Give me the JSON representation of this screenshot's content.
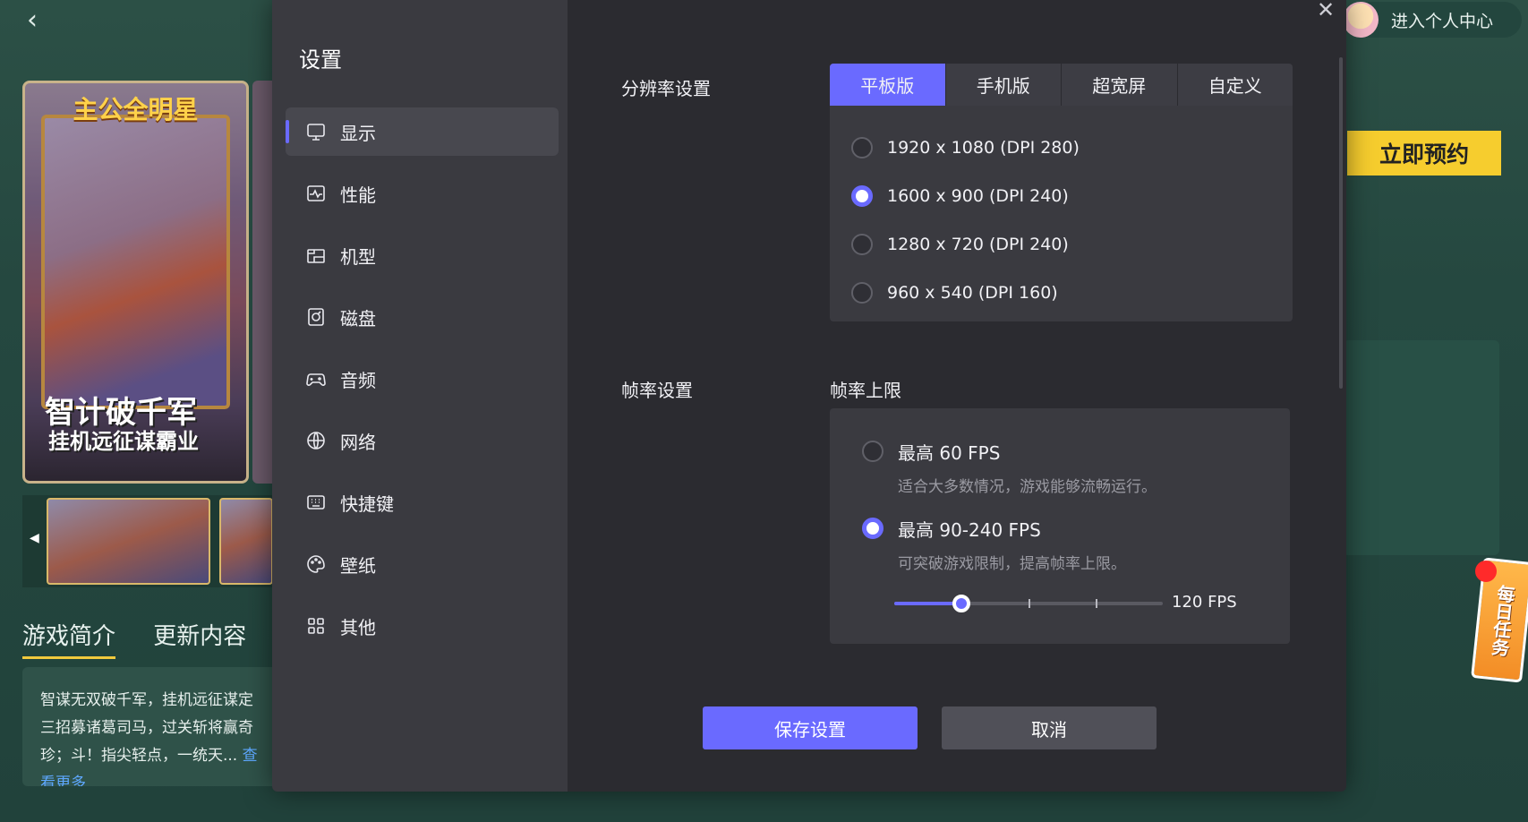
{
  "background": {
    "poster": {
      "title": "主公全明星",
      "slogan_line1": "智计破千军",
      "slogan_line2": "挂机远征谋霸业"
    },
    "tabs": [
      "游戏简介",
      "更新内容"
    ],
    "description": "智谋无双破千军，挂机远征谋定三招募诸葛司马，过关斩将赢奇珍；斗！指尖轻点，一统天...",
    "more_link": "查看更多",
    "user_center": "进入个人中心",
    "reserve_button": "立即预约",
    "daily_task": "每日任务"
  },
  "settings": {
    "title": "设置",
    "nav": [
      {
        "label": "显示",
        "icon": "monitor-icon",
        "active": true
      },
      {
        "label": "性能",
        "icon": "performance-icon",
        "active": false
      },
      {
        "label": "机型",
        "icon": "device-icon",
        "active": false
      },
      {
        "label": "磁盘",
        "icon": "disk-icon",
        "active": false
      },
      {
        "label": "音频",
        "icon": "gamepad-icon",
        "active": false
      },
      {
        "label": "网络",
        "icon": "globe-icon",
        "active": false
      },
      {
        "label": "快捷键",
        "icon": "keyboard-icon",
        "active": false
      },
      {
        "label": "壁纸",
        "icon": "palette-icon",
        "active": false
      },
      {
        "label": "其他",
        "icon": "grid-icon",
        "active": false
      }
    ],
    "resolution": {
      "label": "分辨率设置",
      "tabs": [
        "平板版",
        "手机版",
        "超宽屏",
        "自定义"
      ],
      "active_tab": "平板版",
      "options": [
        {
          "text": "1920 x 1080  (DPI 280)",
          "checked": false
        },
        {
          "text": "1600 x 900  (DPI 240)",
          "checked": true
        },
        {
          "text": "1280 x 720  (DPI 240)",
          "checked": false
        },
        {
          "text": "960 x 540  (DPI 160)",
          "checked": false
        }
      ]
    },
    "framerate": {
      "label": "帧率设置",
      "sublabel": "帧率上限",
      "options": [
        {
          "title": "最高 60 FPS",
          "desc": "适合大多数情况，游戏能够流畅运行。",
          "checked": false
        },
        {
          "title": "最高 90-240 FPS",
          "desc": "可突破游戏限制，提高帧率上限。",
          "checked": true
        }
      ],
      "slider_value": "120 FPS",
      "slider_fraction": 0.25,
      "slider_ticks": [
        0.5,
        0.75
      ]
    },
    "save_button": "保存设置",
    "cancel_button": "取消",
    "accent_color": "#6a6aff"
  }
}
